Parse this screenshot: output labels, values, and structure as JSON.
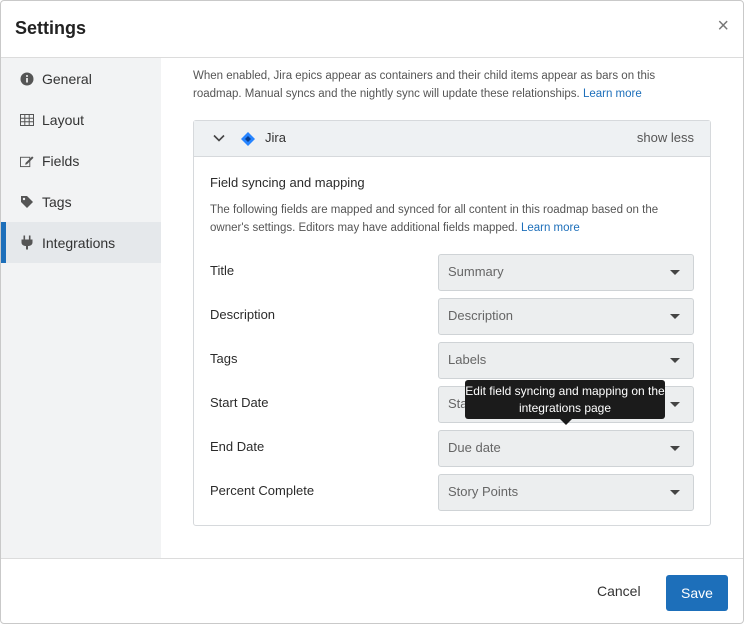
{
  "dialog": {
    "title": "Settings",
    "close_glyph": "×"
  },
  "sidebar": {
    "items": [
      {
        "label": "General",
        "icon": "info-icon"
      },
      {
        "label": "Layout",
        "icon": "grid-icon"
      },
      {
        "label": "Fields",
        "icon": "edit-field-icon"
      },
      {
        "label": "Tags",
        "icon": "tag-icon"
      },
      {
        "label": "Integrations",
        "icon": "plug-icon",
        "active": true
      }
    ]
  },
  "content": {
    "intro": "When enabled, Jira epics appear as containers and their child items appear as bars on this roadmap. Manual syncs and the nightly sync will update these relationships.",
    "intro_link": "Learn more",
    "integration": {
      "name": "Jira",
      "toggle_label": "show less",
      "section_title": "Field syncing and mapping",
      "section_desc": "The following fields are mapped and synced for all content in this roadmap based on the owner's settings. Editors may have additional fields mapped.",
      "section_link": "Learn more",
      "mappings": [
        {
          "label": "Title",
          "value": "Summary"
        },
        {
          "label": "Description",
          "value": "Description"
        },
        {
          "label": "Tags",
          "value": "Labels"
        },
        {
          "label": "Start Date",
          "value": "Start date"
        },
        {
          "label": "End Date",
          "value": "Due date"
        },
        {
          "label": "Percent Complete",
          "value": "Story Points"
        }
      ]
    },
    "tooltip": "Edit field syncing and mapping on the integrations page"
  },
  "footer": {
    "cancel_label": "Cancel",
    "save_label": "Save"
  },
  "colors": {
    "accent": "#1d6fba",
    "sidebar_bg": "#f2f3f4",
    "tooltip_bg": "#1b1b1b"
  }
}
